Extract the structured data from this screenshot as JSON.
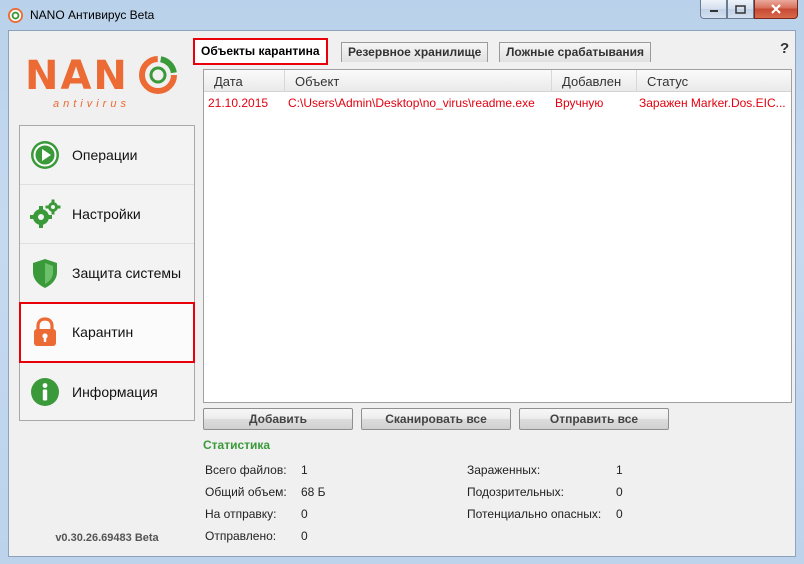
{
  "window": {
    "title": "NANO Антивирус Beta"
  },
  "logo": {
    "main": "NAN",
    "sub": "antivirus"
  },
  "colors": {
    "accent": "#ec6a34",
    "green": "#3a9a3a",
    "danger": "#e3000f",
    "highlight": "#e8000b"
  },
  "sidebar": {
    "items": [
      {
        "label": "Операции",
        "icon": "play-icon"
      },
      {
        "label": "Настройки",
        "icon": "gears-icon"
      },
      {
        "label": "Защита системы",
        "icon": "shield-icon"
      },
      {
        "label": "Карантин",
        "icon": "lock-icon",
        "selected": true
      },
      {
        "label": "Информация",
        "icon": "info-icon"
      }
    ]
  },
  "version": "v0.30.26.69483 Beta",
  "tabs": [
    "Объекты карантина",
    "Резервное хранилище",
    "Ложные срабатывания"
  ],
  "help": "?",
  "table": {
    "columns": [
      "Дата",
      "Объект",
      "Добавлен",
      "Статус"
    ],
    "rows": [
      {
        "date": "21.10.2015",
        "object": "C:\\Users\\Admin\\Desktop\\no_virus\\readme.exe",
        "added": "Вручную",
        "status": "Заражен Marker.Dos.EIC..."
      }
    ]
  },
  "buttons": {
    "add": "Добавить",
    "scan_all": "Сканировать все",
    "send_all": "Отправить все"
  },
  "stats": {
    "title": "Статистика",
    "total_files_label": "Всего файлов:",
    "total_files": "1",
    "total_size_label": "Общий объем:",
    "total_size": "68 Б",
    "to_send_label": "На отправку:",
    "to_send": "0",
    "sent_label": "Отправлено:",
    "sent": "0",
    "infected_label": "Зараженных:",
    "infected": "1",
    "suspicious_label": "Подозрительных:",
    "suspicious": "0",
    "dangerous_label": "Потенциально опасных:",
    "dangerous": "0"
  }
}
